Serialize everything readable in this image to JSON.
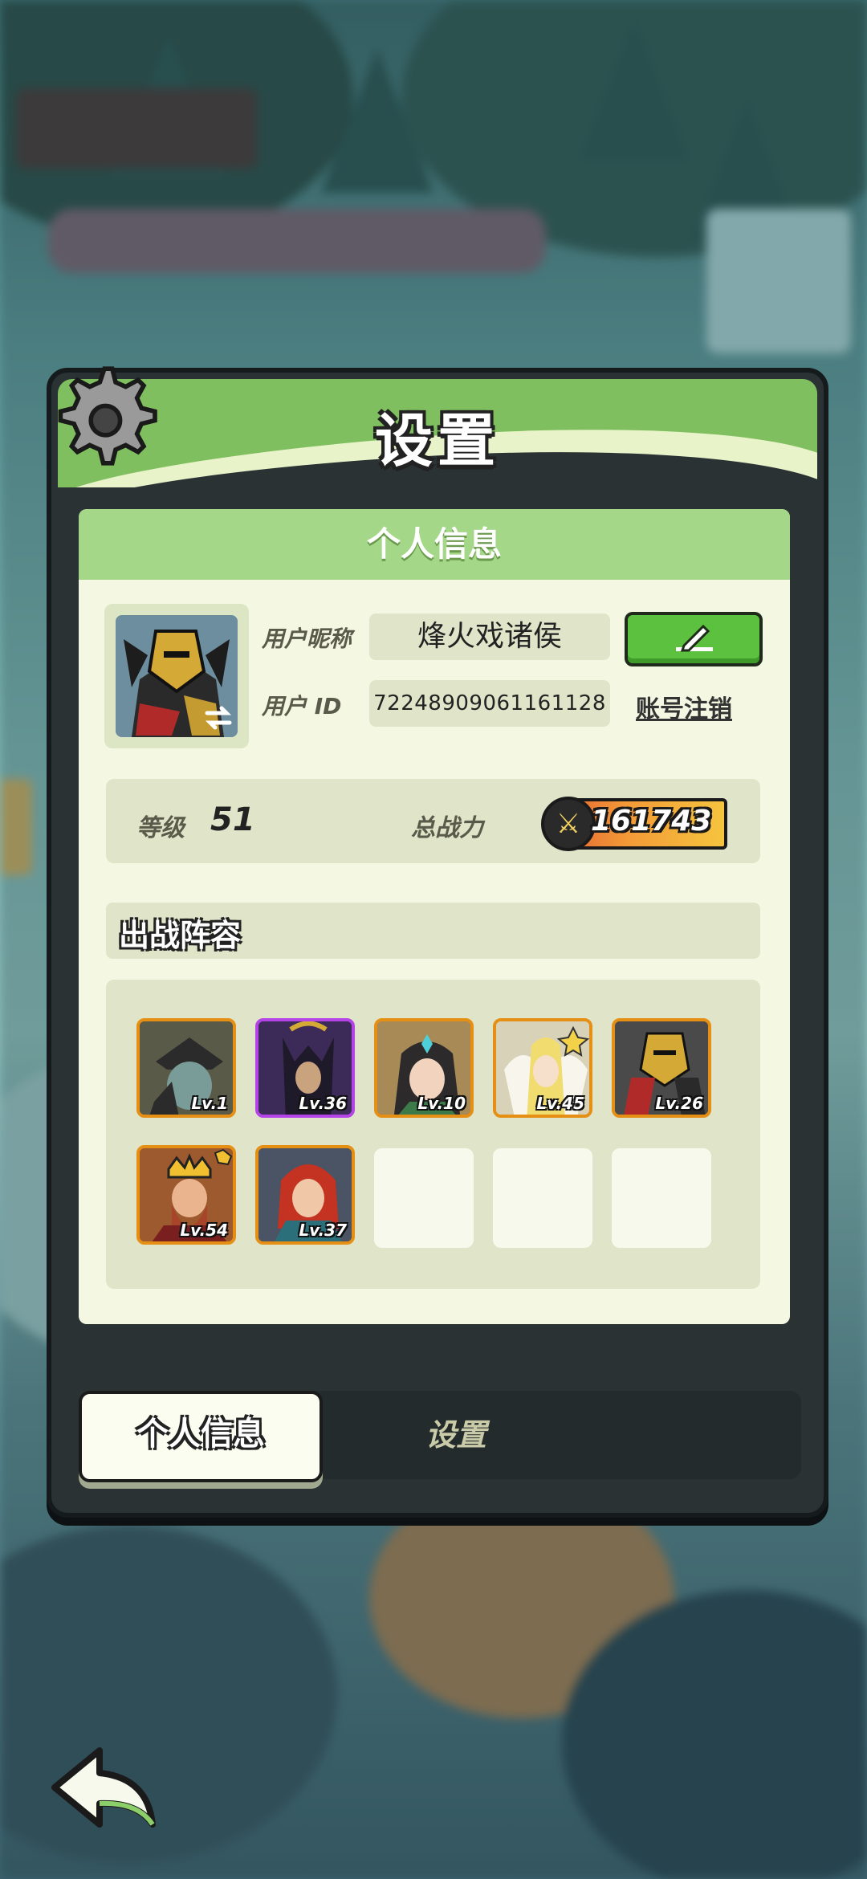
{
  "dialog": {
    "title": "设置",
    "panel_header": "个人信息",
    "profile": {
      "nickname_label": "用户昵称",
      "nickname": "烽火戏诸侯",
      "id_label": "用户  ID",
      "user_id": "72248909061161128",
      "delete_account": "账号注销"
    },
    "stats": {
      "level_label": "等级",
      "level": "51",
      "power_label": "总战力",
      "power": "161743"
    },
    "lineup": {
      "title": "出战阵容",
      "heroes": [
        {
          "level": "Lv.1"
        },
        {
          "level": "Lv.36"
        },
        {
          "level": "Lv.10"
        },
        {
          "level": "Lv.45"
        },
        {
          "level": "Lv.26"
        },
        {
          "level": "Lv.54"
        },
        {
          "level": "Lv.37"
        }
      ]
    },
    "tabs": {
      "active": "个人信息",
      "inactive": "设置"
    }
  },
  "colors": {
    "header_green": "#7fbf5f",
    "panel_bg": "#f4f8e2",
    "edit_button": "#5cc13e",
    "orange_frame": "#e58f14",
    "purple_frame": "#b444e8"
  },
  "icons": {
    "settings": "gear-icon",
    "edit": "pencil-icon",
    "swap": "swap-arrows-icon",
    "power": "crossed-swords-icon",
    "back": "back-arrow-icon"
  }
}
